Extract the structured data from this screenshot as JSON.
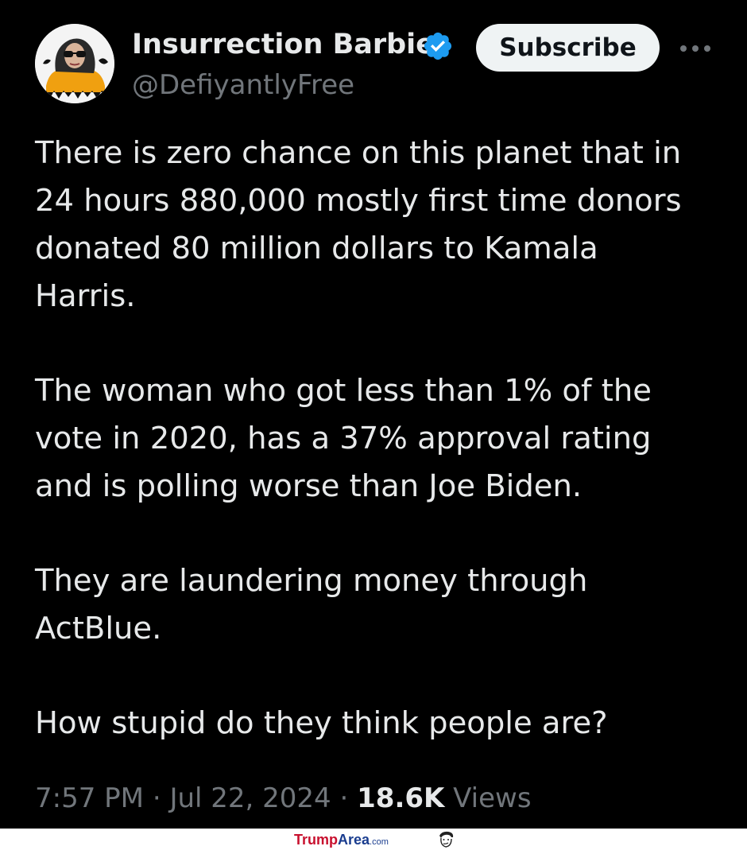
{
  "author": {
    "name": "Insurrection Barbie",
    "handle": "@DefiyantlyFree",
    "avatar_icon": "profile-photo",
    "verified_icon": "verified-badge-icon",
    "verified_color": "#1d9bf0"
  },
  "actions": {
    "subscribe_label": "Subscribe",
    "more_icon": "more-options-icon"
  },
  "tweet": {
    "paragraphs": [
      "There is zero chance on this planet that in\n24 hours 880,000 mostly first time donors\ndonated 80 million dollars to Kamala\nHarris.",
      "The woman who got less than 1% of the\nvote in 2020, has a 37% approval rating\nand is polling worse than Joe Biden.",
      "They are laundering money through\nActBlue.",
      "How stupid do they think people are?"
    ]
  },
  "meta": {
    "time": "7:57 PM",
    "separator": "·",
    "date": "Jul 22, 2024",
    "views_count": "18.6K",
    "views_label": "Views"
  },
  "watermark": {
    "part1": "Trump",
    "part2": "Area",
    "part3": ".com"
  },
  "colors": {
    "background": "#000000",
    "text": "#e7e9ea",
    "secondary_text": "#71767b",
    "button_bg": "#eff3f4"
  }
}
